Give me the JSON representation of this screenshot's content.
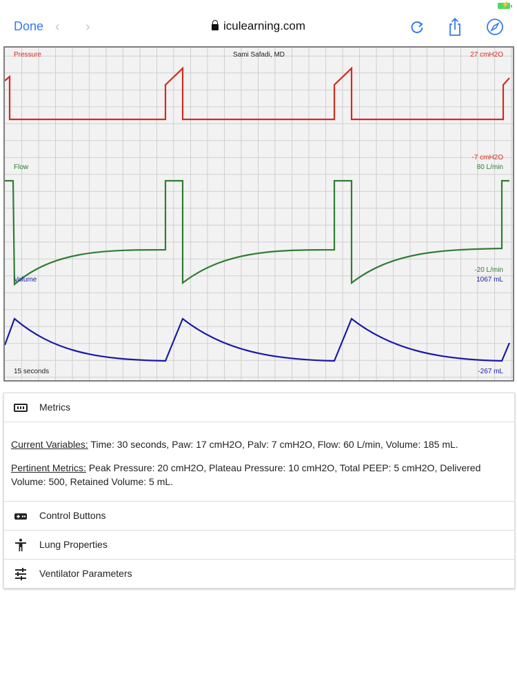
{
  "browser": {
    "done_label": "Done",
    "back_icon": "chevron-left-icon",
    "forward_icon": "chevron-right-icon",
    "url": "iculearning.com",
    "reload_icon": "reload-icon",
    "share_icon": "share-icon",
    "safari_icon": "compass-icon"
  },
  "monitor": {
    "author": "Sami Safadi, MD",
    "pressure": {
      "label": "Pressure",
      "max": "27 cmH2O",
      "min": "-7 cmH2O",
      "color": "#d42a1e"
    },
    "flow": {
      "label": "Flow",
      "max": "80 L/min",
      "min": "-20 L/min",
      "color": "#2e7d32"
    },
    "volume": {
      "label": "Volume",
      "max": "1067 mL",
      "min": "-267 mL",
      "color": "#1a1aa8"
    },
    "time_window": "15 seconds"
  },
  "panel": {
    "metrics": {
      "title": "Metrics",
      "icon": "metrics-icon",
      "current_label": "Current Variables:",
      "current_text": " Time: 30 seconds, Paw: 17 cmH2O, Palv: 7 cmH2O, Flow: 60 L/min, Volume: 185 mL.",
      "pertinent_label": "Pertinent Metrics:",
      "pertinent_text": " Peak Pressure: 20 cmH2O, Plateau Pressure: 10 cmH2O, Total PEEP: 5 cmH2O, Delivered Volume: 500, Retained Volume: 5 mL."
    },
    "control": {
      "title": "Control Buttons",
      "icon": "gamepad-icon"
    },
    "lung": {
      "title": "Lung Properties",
      "icon": "person-icon"
    },
    "vent": {
      "title": "Ventilator Parameters",
      "icon": "sliders-icon"
    }
  }
}
